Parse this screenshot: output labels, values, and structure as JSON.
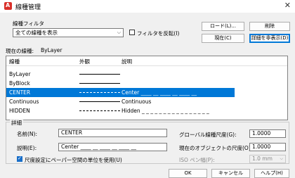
{
  "window": {
    "title": "線種管理",
    "icon_letter": "A"
  },
  "filter": {
    "label": "線種フィルタ",
    "selected": "全ての線種を表示",
    "invert_label": "フィルタを反転(I)",
    "invert_checked": false
  },
  "buttons": {
    "load": "ロード(L)...",
    "delete": "削除",
    "current": "現在(C)",
    "hide_details": "詳細を非表示(D)",
    "ok": "OK",
    "cancel": "キャンセル",
    "help": "ヘルプ(H)"
  },
  "current_linetype": {
    "label": "現在の線種:",
    "value": "ByLayer"
  },
  "list": {
    "columns": [
      "線種",
      "外観",
      "説明"
    ],
    "rows": [
      {
        "name": "ByLayer",
        "description": "",
        "selected": false
      },
      {
        "name": "ByBlock",
        "description": "",
        "selected": false
      },
      {
        "name": "CENTER",
        "description": "Center ____ __ ____ __ ____ __",
        "selected": true
      },
      {
        "name": "Continuous",
        "description": "Continuous",
        "selected": false
      },
      {
        "name": "HIDDEN",
        "description": "Hidden _ _ _ _ _ _ _ _ _ _ _ _ _ _ _ _",
        "selected": false
      }
    ]
  },
  "details": {
    "group_label": "詳細",
    "name_label": "名前(N):",
    "name_value": "CENTER",
    "desc_label": "説明(E):",
    "desc_value": "Center ____ __ ____ __ ____ __",
    "paper_space_label": "尺度設定にペーパー空間の単位を使用(U)",
    "paper_space_checked": true,
    "global_scale_label": "グローバル線種尺度(G):",
    "global_scale_value": "1.0000",
    "object_scale_label": "現在のオブジェクトの尺度(O):",
    "object_scale_value": "1.0000",
    "iso_pen_label": "ISO ペン幅(P):",
    "iso_pen_value": "1.0 mm"
  },
  "colors": {
    "accent": "#0078d7",
    "icon": "#d9302a"
  }
}
